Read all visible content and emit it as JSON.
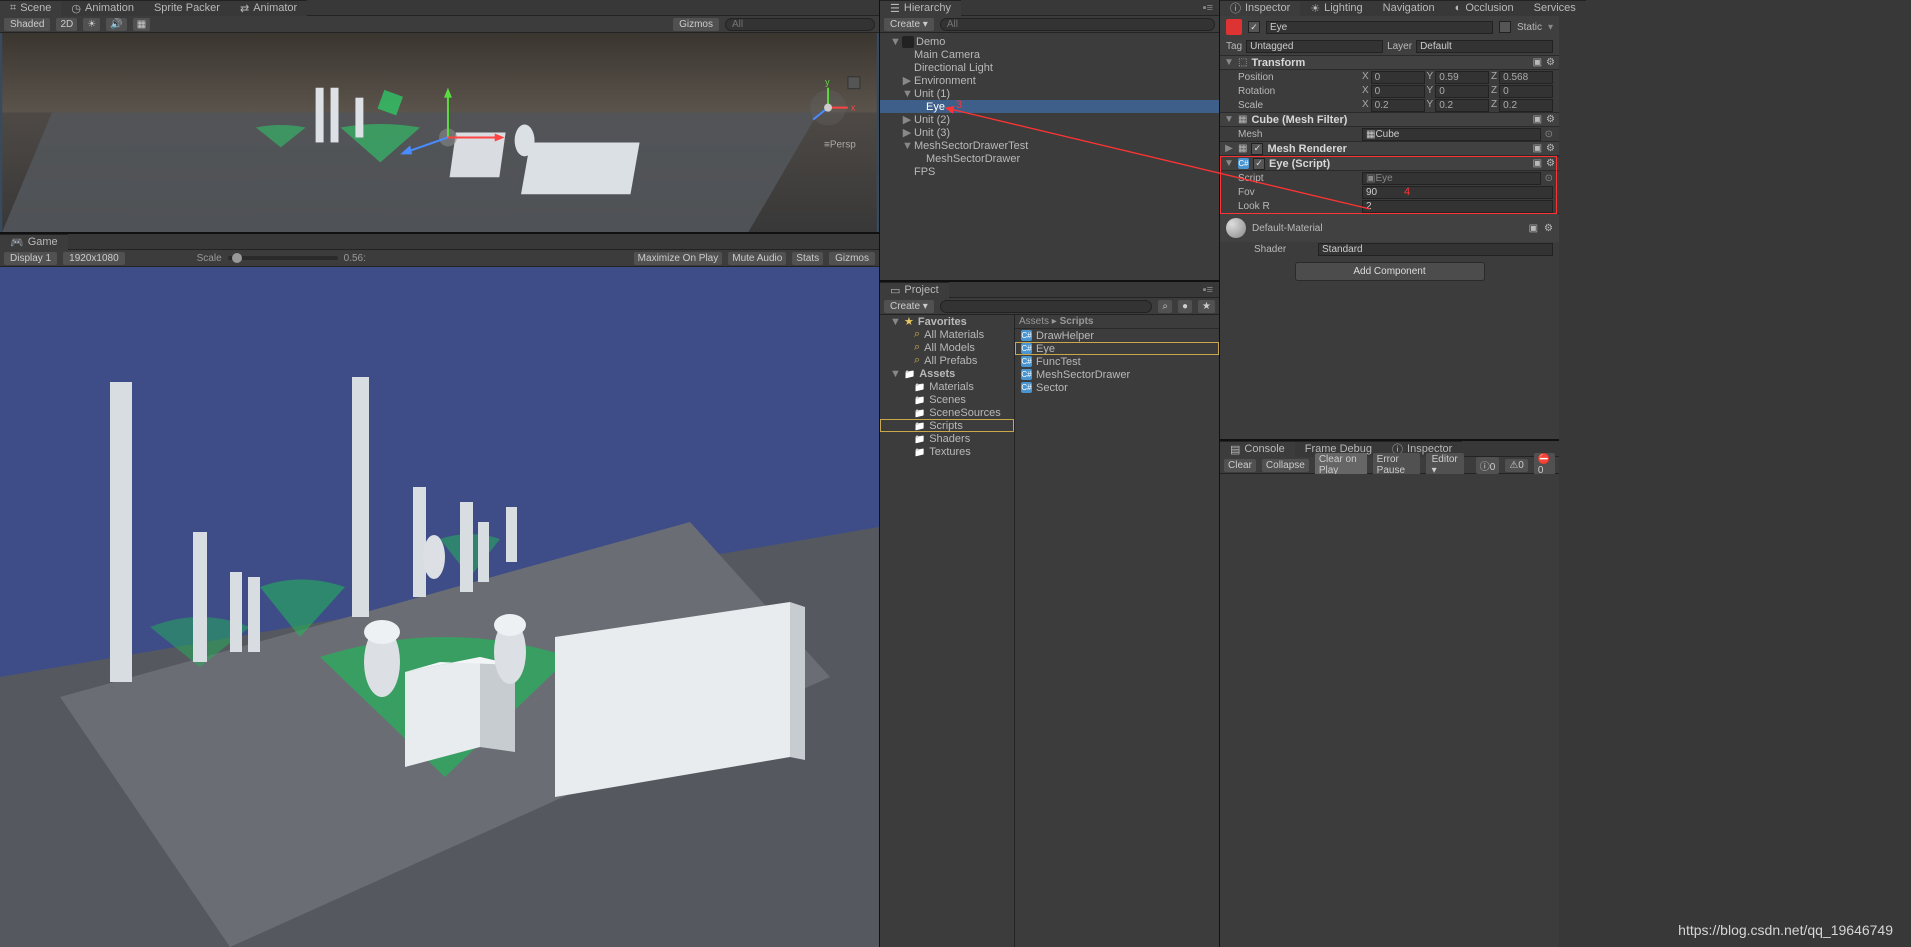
{
  "scene": {
    "tabs": [
      "Scene",
      "Animation",
      "Sprite Packer",
      "Animator"
    ],
    "toolbar": {
      "shading": "Shaded",
      "mode2d": "2D",
      "gizmos": "Gizmos",
      "search": "All",
      "persp": "Persp"
    }
  },
  "game": {
    "tab": "Game",
    "display": "Display 1",
    "res": "1920x1080",
    "scaleLabel": "Scale",
    "scaleVal": "0.56:",
    "maxLabel": "Maximize On Play",
    "mute": "Mute Audio",
    "stats": "Stats",
    "gizmos": "Gizmos"
  },
  "hierarchy": {
    "tab": "Hierarchy",
    "create": "Create",
    "search": "All",
    "items": [
      {
        "d": 0,
        "label": "Demo",
        "fold": "▼",
        "icon": "unity"
      },
      {
        "d": 1,
        "label": "Main Camera"
      },
      {
        "d": 1,
        "label": "Directional Light"
      },
      {
        "d": 1,
        "label": "Environment",
        "fold": "▶"
      },
      {
        "d": 1,
        "label": "Unit (1)",
        "fold": "▼"
      },
      {
        "d": 2,
        "label": "Eye",
        "sel": true
      },
      {
        "d": 1,
        "label": "Unit (2)",
        "fold": "▶"
      },
      {
        "d": 1,
        "label": "Unit (3)",
        "fold": "▶"
      },
      {
        "d": 1,
        "label": "MeshSectorDrawerTest",
        "fold": "▼"
      },
      {
        "d": 2,
        "label": "MeshSectorDrawer"
      },
      {
        "d": 1,
        "label": "FPS"
      }
    ]
  },
  "project": {
    "tab": "Project",
    "create": "Create",
    "breadcrumb": [
      "Assets",
      "Scripts"
    ],
    "left": [
      {
        "d": 0,
        "label": "Favorites",
        "icon": "star",
        "fold": "▼"
      },
      {
        "d": 1,
        "label": "All Materials",
        "icon": "q"
      },
      {
        "d": 1,
        "label": "All Models",
        "icon": "q"
      },
      {
        "d": 1,
        "label": "All Prefabs",
        "icon": "q"
      },
      {
        "d": 0,
        "label": "Assets",
        "icon": "folder",
        "fold": "▼"
      },
      {
        "d": 1,
        "label": "Materials",
        "icon": "folder"
      },
      {
        "d": 1,
        "label": "Scenes",
        "icon": "folder"
      },
      {
        "d": 1,
        "label": "SceneSources",
        "icon": "folder"
      },
      {
        "d": 1,
        "label": "Scripts",
        "icon": "folder",
        "sel": true
      },
      {
        "d": 1,
        "label": "Shaders",
        "icon": "folder"
      },
      {
        "d": 1,
        "label": "Textures",
        "icon": "folder"
      }
    ],
    "right": [
      {
        "label": "DrawHelper"
      },
      {
        "label": "Eye",
        "sel": true
      },
      {
        "label": "FuncTest"
      },
      {
        "label": "MeshSectorDrawer"
      },
      {
        "label": "Sector"
      }
    ]
  },
  "inspector": {
    "tabs": [
      "Inspector",
      "Lighting",
      "Navigation",
      "Occlusion",
      "Services"
    ],
    "name": "Eye",
    "static": "Static",
    "tag": "Tag",
    "tagVal": "Untagged",
    "layer": "Layer",
    "layerVal": "Default",
    "transform": {
      "title": "Transform",
      "pos": {
        "x": "0",
        "y": "0.59",
        "z": "0.568"
      },
      "rot": {
        "x": "0",
        "y": "0",
        "z": "0"
      },
      "scale": {
        "x": "0.2",
        "y": "0.2",
        "z": "0.2"
      }
    },
    "meshFilter": {
      "title": "Cube (Mesh Filter)",
      "meshLabel": "Mesh",
      "meshVal": "Cube"
    },
    "meshRenderer": {
      "title": "Mesh Renderer"
    },
    "eyeScript": {
      "title": "Eye (Script)",
      "scriptLabel": "Script",
      "scriptVal": "Eye",
      "fovLabel": "Fov",
      "fovVal": "90",
      "lookLabel": "Look R",
      "lookVal": "2"
    },
    "material": {
      "title": "Default-Material",
      "shaderLabel": "Shader",
      "shaderVal": "Standard"
    },
    "addComponent": "Add Component"
  },
  "console": {
    "tabs": [
      "Console",
      "Frame Debug",
      "Inspector"
    ],
    "btns": [
      "Clear",
      "Collapse",
      "Clear on Play",
      "Error Pause",
      "Editor"
    ],
    "counts": [
      "0",
      "0",
      "0"
    ]
  },
  "annotations": {
    "num3": "3",
    "num4": "4"
  },
  "footer": "https://blog.csdn.net/qq_19646749"
}
